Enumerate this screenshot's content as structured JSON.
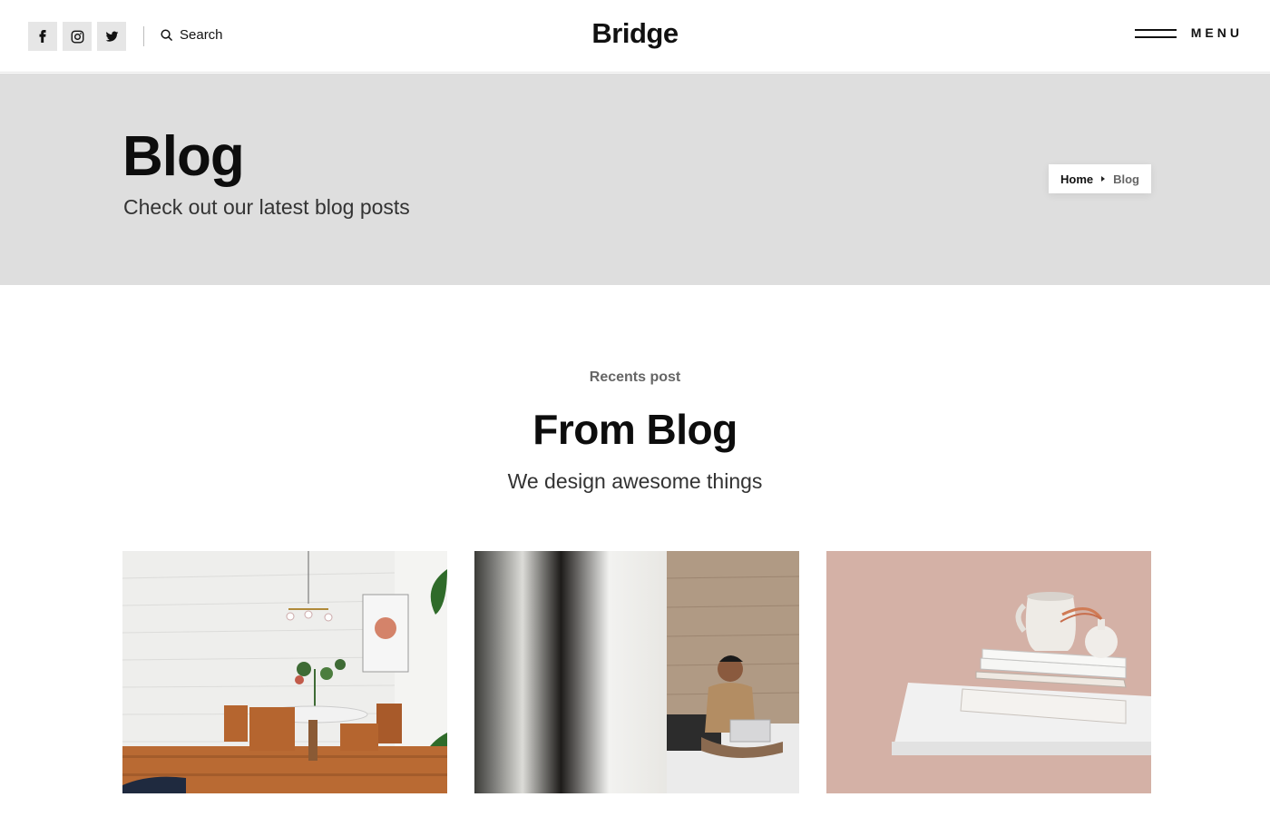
{
  "header": {
    "logo": "Bridge",
    "search_label": "Search",
    "menu_label": "MENU",
    "social_icons": [
      "facebook-icon",
      "instagram-icon",
      "twitter-icon"
    ]
  },
  "title_band": {
    "title": "Blog",
    "subtitle": "Check out our latest blog posts",
    "breadcrumb": {
      "home": "Home",
      "current": "Blog"
    }
  },
  "section": {
    "eyebrow": "Recents post",
    "title": "From Blog",
    "subtitle": "We design awesome things"
  },
  "posts": [
    {
      "image": "dining-room-photo"
    },
    {
      "image": "man-with-laptop-photo"
    },
    {
      "image": "books-and-vases-photo"
    }
  ],
  "colors": {
    "band_bg": "#dedede",
    "social_bg": "#e6e6e6",
    "text_dark": "#111111",
    "text_muted": "#666666"
  }
}
